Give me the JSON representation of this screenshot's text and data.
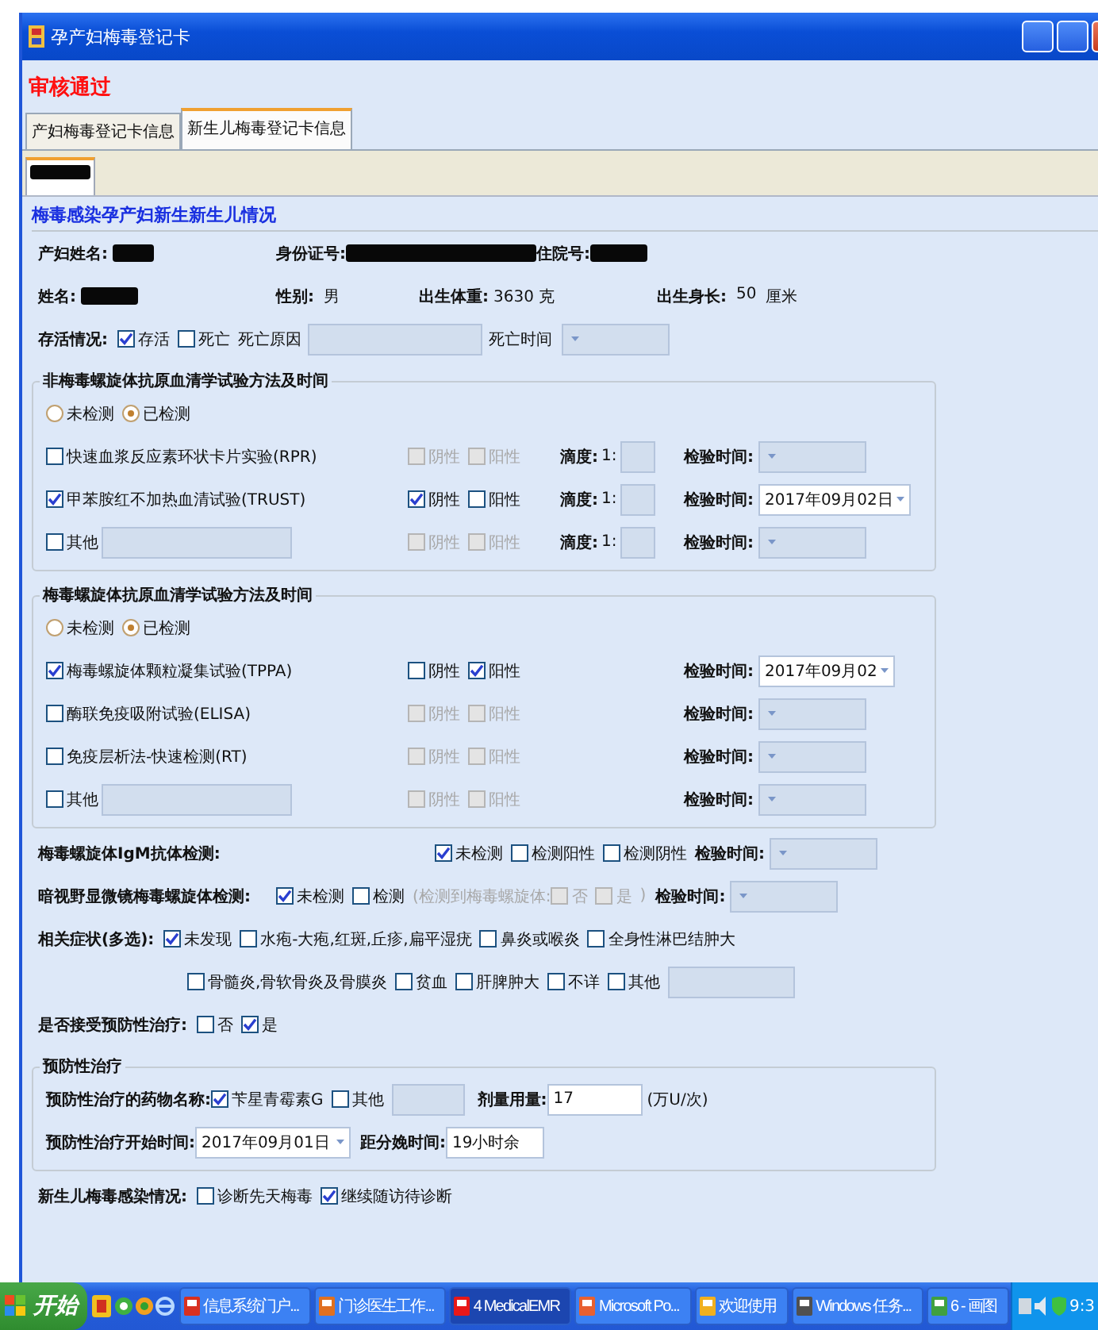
{
  "window": {
    "title": "孕产妇梅毒登记卡"
  },
  "status": "审核通过",
  "tabs": [
    {
      "label": "产妇梅毒登记卡信息",
      "selected": false
    },
    {
      "label": "新生儿梅毒登记卡信息",
      "selected": true
    }
  ],
  "section": {
    "title": "梅毒感染孕产妇新生新生儿情况"
  },
  "mother": {
    "name_label": "产妇姓名:",
    "id_label": "身份证号:",
    "admission_label": "住院号:"
  },
  "baby": {
    "name_label": "姓名:",
    "sex_label": "性别:",
    "sex": "男",
    "weight_label": "出生体重:",
    "weight": "3630 克",
    "length_label": "出生身长:",
    "length": "50",
    "length_unit": "厘米"
  },
  "survival": {
    "label": "存活情况:",
    "options": [
      {
        "label": "存活",
        "checked": true
      },
      {
        "label": "死亡",
        "checked": false
      }
    ],
    "cause_label": "死亡原因",
    "time_label": "死亡时间"
  },
  "nontreponemal": {
    "title": "非梅毒螺旋体抗原血清学试验方法及时间",
    "radios": [
      {
        "label": "未检测",
        "selected": false
      },
      {
        "label": "已检测",
        "selected": true
      }
    ],
    "tests": [
      {
        "kind": "named",
        "label": "快速血浆反应素环状卡片实验(RPR)",
        "checked": false,
        "negative": {
          "label": "阴性",
          "checked": false
        },
        "positive": {
          "label": "阳性",
          "checked": false
        },
        "titer_label": "滴度:",
        "titer_ratio": "1:",
        "date_label": "检验时间:"
      },
      {
        "kind": "named",
        "label": "甲苯胺红不加热血清试验(TRUST)",
        "checked": true,
        "negative": {
          "label": "阴性",
          "checked": true
        },
        "positive": {
          "label": "阳性",
          "checked": false
        },
        "titer_label": "滴度:",
        "titer_ratio": "1:",
        "date_label": "检验时间:",
        "date": "2017年09月02日"
      },
      {
        "kind": "other",
        "label": "其他",
        "checked": false,
        "negative": {
          "label": "阴性",
          "checked": false
        },
        "positive": {
          "label": "阳性",
          "checked": false
        },
        "titer_label": "滴度:",
        "titer_ratio": "1:",
        "date_label": "检验时间:"
      }
    ]
  },
  "treponemal": {
    "title": "梅毒螺旋体抗原血清学试验方法及时间",
    "radios": [
      {
        "label": "未检测",
        "selected": false
      },
      {
        "label": "已检测",
        "selected": true
      }
    ],
    "tests": [
      {
        "kind": "named",
        "label": "梅毒螺旋体颗粒凝集试验(TPPA)",
        "checked": true,
        "negative": {
          "label": "阴性",
          "checked": false
        },
        "positive": {
          "label": "阳性",
          "checked": true
        },
        "date_label": "检验时间:",
        "date": "2017年09月02"
      },
      {
        "kind": "named",
        "label": "酶联免疫吸附试验(ELISA)",
        "checked": false,
        "negative": {
          "label": "阴性",
          "checked": false
        },
        "positive": {
          "label": "阳性",
          "checked": false
        },
        "date_label": "检验时间:"
      },
      {
        "kind": "named",
        "label": "免疫层析法-快速检测(RT)",
        "checked": false,
        "negative": {
          "label": "阴性",
          "checked": false
        },
        "positive": {
          "label": "阳性",
          "checked": false
        },
        "date_label": "检验时间:"
      },
      {
        "kind": "other",
        "label": "其他",
        "checked": false,
        "negative": {
          "label": "阴性",
          "checked": false
        },
        "positive": {
          "label": "阳性",
          "checked": false
        },
        "date_label": "检验时间:"
      }
    ]
  },
  "igm": {
    "label": "梅毒螺旋体IgM抗体检测:",
    "options": [
      {
        "label": "未检测",
        "checked": true
      },
      {
        "label": "检测阳性",
        "checked": false
      },
      {
        "label": "检测阴性",
        "checked": false
      }
    ],
    "date_label": "检验时间:"
  },
  "darkfield": {
    "label": "暗视野显微镜梅毒螺旋体检测:",
    "options": [
      {
        "label": "未检测",
        "checked": true
      },
      {
        "label": "检测",
        "checked": false
      }
    ],
    "note_open": "(检测到梅毒螺旋体:",
    "sub_options": [
      {
        "label": "否",
        "checked": false
      },
      {
        "label": "是",
        "checked": false
      }
    ],
    "note_close": ")",
    "date_label": "检验时间:"
  },
  "symptoms": {
    "label": "相关症状(多选):",
    "lines": [
      [
        {
          "label": "未发现",
          "checked": true
        },
        {
          "label": "水疱-大疱,红斑,丘疹,扁平湿疣",
          "checked": false
        },
        {
          "label": "鼻炎或喉炎",
          "checked": false
        },
        {
          "label": "全身性淋巴结肿大",
          "checked": false
        }
      ],
      [
        {
          "label": "骨髓炎,骨软骨炎及骨膜炎",
          "checked": false
        },
        {
          "label": "贫血",
          "checked": false
        },
        {
          "label": "肝脾肿大",
          "checked": false
        },
        {
          "label": "不详",
          "checked": false
        },
        {
          "label": "其他",
          "checked": false
        }
      ]
    ]
  },
  "prevention": {
    "label": "是否接受预防性治疗:",
    "options": [
      {
        "label": "否",
        "checked": false
      },
      {
        "label": "是",
        "checked": true
      }
    ]
  },
  "treatment": {
    "title": "预防性治疗",
    "drug_label": "预防性治疗的药物名称:",
    "drugs": [
      {
        "label": "苄星青霉素G",
        "checked": true
      },
      {
        "label": "其他",
        "checked": false
      }
    ],
    "dose_label": "剂量用量:",
    "dose": "17",
    "dose_unit": "(万U/次)",
    "start_label": "预防性治疗开始时间:",
    "start": "2017年09月01日",
    "interval_label": "距分娩时间:",
    "interval": "19小时余"
  },
  "infection": {
    "label": "新生儿梅毒感染情况:",
    "options": [
      {
        "label": "诊断先天梅毒",
        "checked": false
      },
      {
        "label": "继续随访待诊断",
        "checked": true
      }
    ]
  },
  "taskbar": {
    "start": "开始",
    "tasks": [
      {
        "label": "信息系统门户...",
        "selected": false
      },
      {
        "label": "门诊医生工作...",
        "selected": false
      },
      {
        "label": "4 MedicalEMR",
        "selected": true
      },
      {
        "label": "Microsoft Po...",
        "selected": false
      },
      {
        "label": "欢迎使用",
        "selected": false
      },
      {
        "label": "Windows 任务...",
        "selected": false
      },
      {
        "label": "6 - 画图",
        "selected": false
      }
    ],
    "clock": "9:3"
  }
}
